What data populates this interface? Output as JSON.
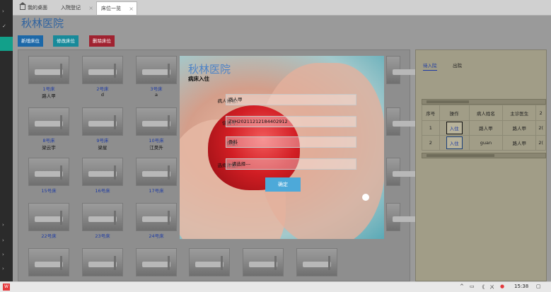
{
  "tabs": [
    {
      "label": "我的桌面"
    },
    {
      "label": "入院登记"
    },
    {
      "label": "床位一览"
    }
  ],
  "hospital_name": "秋林医院",
  "toolbar": {
    "add_label": "新增床位",
    "edit_label": "修改床位",
    "delete_label": "删除床位"
  },
  "beds": [
    {
      "no": "1号床",
      "patient": "路人甲"
    },
    {
      "no": "2号床",
      "patient": "d"
    },
    {
      "no": "3号床",
      "patient": "a"
    },
    {
      "no": "8号床",
      "patient": "梁云宇"
    },
    {
      "no": "9号床",
      "patient": "梁星"
    },
    {
      "no": "10号床",
      "patient": "江昊升"
    },
    {
      "no": "15号床",
      "patient": ""
    },
    {
      "no": "16号床",
      "patient": ""
    },
    {
      "no": "17号床",
      "patient": ""
    },
    {
      "no": "22号床",
      "patient": ""
    },
    {
      "no": "23号床",
      "patient": ""
    },
    {
      "no": "24号床",
      "patient": ""
    }
  ],
  "right_panel": {
    "tab_pending": "待入院",
    "tab_discharge": "出院",
    "columns": [
      "序号",
      "操作",
      "病人姓名",
      "主诊医生",
      "2"
    ],
    "rows": [
      {
        "index": "1",
        "action": "入住",
        "patient": "路人甲",
        "doctor": "路人甲",
        "more": "2("
      },
      {
        "index": "2",
        "action": "入住",
        "patient": "guan",
        "doctor": "路人甲",
        "more": "2("
      }
    ]
  },
  "modal": {
    "title": "秋林医院",
    "subtitle": "病床入住",
    "name_label": "病人姓名：",
    "name_value": "路人甲",
    "admission_label": "住院号：",
    "admission_value": "ZYH20211212184402912",
    "dept_label": "科室：",
    "dept_value": "骨科",
    "bed_label": "选择床位：",
    "bed_value": "--请选择---",
    "ok_label": "确定"
  },
  "taskbar": {
    "time": "15:38",
    "volume_mark": "《",
    "battery_mark": "ㄨ"
  }
}
